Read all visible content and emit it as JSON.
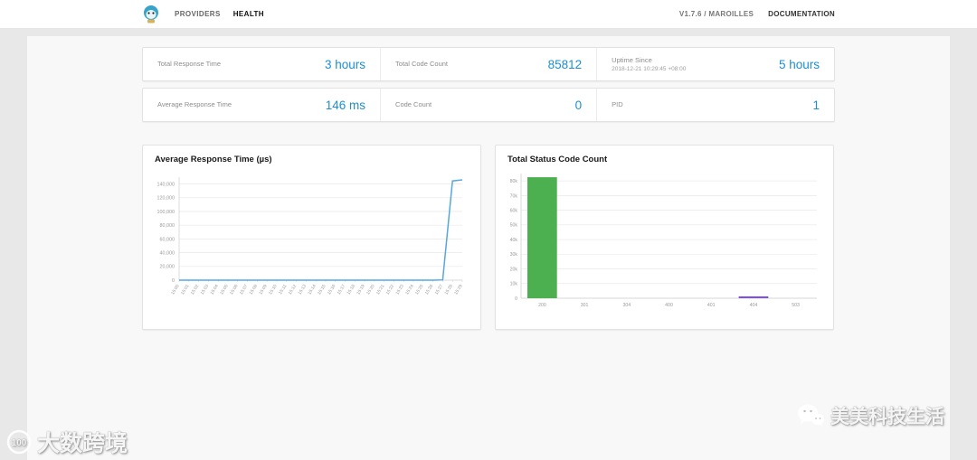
{
  "colors": {
    "accent_blue": "#1d8fd1",
    "page_bg": "#e8e8e8",
    "panel_bg": "#f8f8f8",
    "bar_green": "#4caf50",
    "bar_purple": "#7e57c2",
    "line_blue": "#55a8dd"
  },
  "nav": {
    "items": [
      {
        "label": "PROVIDERS",
        "active": false
      },
      {
        "label": "HEALTH",
        "active": true
      }
    ],
    "version": "V1.7.6 / MAROILLES",
    "documentation": "DOCUMENTATION"
  },
  "stats": {
    "row1": [
      {
        "label": "Total Response Time",
        "value": "3 hours"
      },
      {
        "label": "Total Code Count",
        "value": "85812"
      },
      {
        "label": "Uptime Since",
        "sublabel": "2018-12-21 10:29:45 +08:00",
        "value": "5 hours"
      }
    ],
    "row2": [
      {
        "label": "Average Response Time",
        "value": "146 ms"
      },
      {
        "label": "Code Count",
        "value": "0"
      },
      {
        "label": "PID",
        "value": "1"
      }
    ]
  },
  "chart_data": [
    {
      "type": "line",
      "title": "Average Response Time (µs)",
      "x": [
        "15:00",
        "15:01",
        "15:02",
        "15:03",
        "15:04",
        "15:05",
        "15:06",
        "15:07",
        "15:08",
        "15:09",
        "15:10",
        "15:11",
        "15:12",
        "15:13",
        "15:14",
        "15:15",
        "15:16",
        "15:17",
        "15:18",
        "15:19",
        "15:20",
        "15:21",
        "15:22",
        "15:23",
        "15:24",
        "15:25",
        "15:26",
        "15:27",
        "15:28",
        "15:29"
      ],
      "values": [
        0,
        0,
        0,
        0,
        0,
        0,
        0,
        0,
        0,
        0,
        0,
        0,
        0,
        0,
        0,
        0,
        0,
        0,
        0,
        0,
        0,
        0,
        0,
        0,
        0,
        0,
        0,
        400,
        144500,
        146000
      ],
      "ylim": [
        0,
        150000
      ],
      "yticks": [
        0,
        20000,
        40000,
        60000,
        80000,
        100000,
        120000,
        140000
      ],
      "ytick_labels": [
        "0",
        "20,000",
        "40,000",
        "60,000",
        "80,000",
        "100,000",
        "120,000",
        "140,000"
      ],
      "line_color": "#55a8dd",
      "grid": true,
      "xlabel": "",
      "ylabel": ""
    },
    {
      "type": "bar",
      "title": "Total Status Code Count",
      "categories": [
        "200",
        "301",
        "304",
        "400",
        "401",
        "404",
        "503"
      ],
      "values": [
        82500,
        0,
        0,
        0,
        0,
        1300,
        0
      ],
      "colors": [
        "#4caf50",
        "#66bb6a",
        "#26a69a",
        "#ef5350",
        "#ffa726",
        "#7e57c2",
        "#78909c"
      ],
      "ylim": [
        0,
        85000
      ],
      "yticks": [
        0,
        10000,
        20000,
        30000,
        40000,
        50000,
        60000,
        70000,
        80000
      ],
      "ytick_labels": [
        "0",
        "10k",
        "20k",
        "30k",
        "40k",
        "50k",
        "60k",
        "70k",
        "80k"
      ],
      "grid": true,
      "xlabel": "",
      "ylabel": ""
    }
  ],
  "watermarks": {
    "left_text": "大数跨境",
    "left_logo_text": "100",
    "right_text": "美美科技生活"
  }
}
